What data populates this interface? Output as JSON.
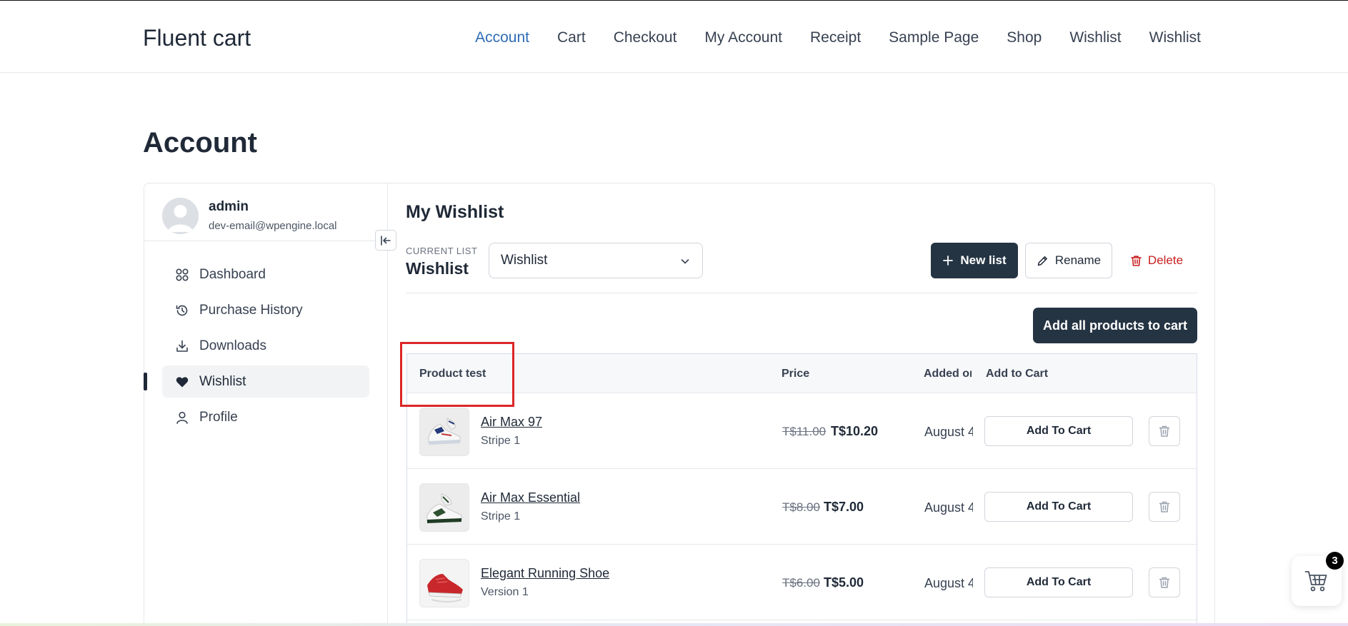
{
  "site": {
    "title": "Fluent cart",
    "nav": [
      {
        "label": "Account",
        "active": true
      },
      {
        "label": "Cart"
      },
      {
        "label": "Checkout"
      },
      {
        "label": "My Account"
      },
      {
        "label": "Receipt"
      },
      {
        "label": "Sample Page"
      },
      {
        "label": "Shop"
      },
      {
        "label": "Wishlist"
      },
      {
        "label": "Wishlist"
      }
    ],
    "accent_color": "#2e6cb5"
  },
  "page": {
    "title": "Account"
  },
  "profile": {
    "name": "admin",
    "email": "dev-email@wpengine.local"
  },
  "sidebar": {
    "items": [
      {
        "label": "Dashboard",
        "icon": "grid-icon"
      },
      {
        "label": "Purchase History",
        "icon": "history-icon"
      },
      {
        "label": "Downloads",
        "icon": "download-icon"
      },
      {
        "label": "Wishlist",
        "icon": "heart-icon",
        "active": true
      },
      {
        "label": "Profile",
        "icon": "user-icon"
      }
    ]
  },
  "wishlist": {
    "title": "My Wishlist",
    "current_list_label": "CURRENT LIST",
    "current_list_name": "Wishlist",
    "selected_list": "Wishlist",
    "new_list_label": "New list",
    "rename_label": "Rename",
    "delete_label": "Delete",
    "add_all_label": "Add all products to cart",
    "columns": {
      "product": "Product test",
      "price": "Price",
      "added_on": "Added on",
      "add_to_cart": "Add to Cart"
    },
    "items": [
      {
        "name": "Air Max 97",
        "variant": "Stripe 1",
        "old_price": "T$11.00",
        "price": "T$10.20",
        "added": "August 4",
        "cart_label": "Add To Cart"
      },
      {
        "name": "Air Max Essential",
        "variant": "Stripe 1",
        "old_price": "T$8.00",
        "price": "T$7.00",
        "added": "August 4",
        "cart_label": "Add To Cart"
      },
      {
        "name": "Elegant Running Shoe",
        "variant": "Version 1",
        "old_price": "T$6.00",
        "price": "T$5.00",
        "added": "August 4",
        "cart_label": "Add To Cart"
      }
    ]
  },
  "cart": {
    "count": "3"
  },
  "colors": {
    "primary_dark": "#253443",
    "danger": "#c81e1e",
    "highlight": "#dc2626"
  }
}
